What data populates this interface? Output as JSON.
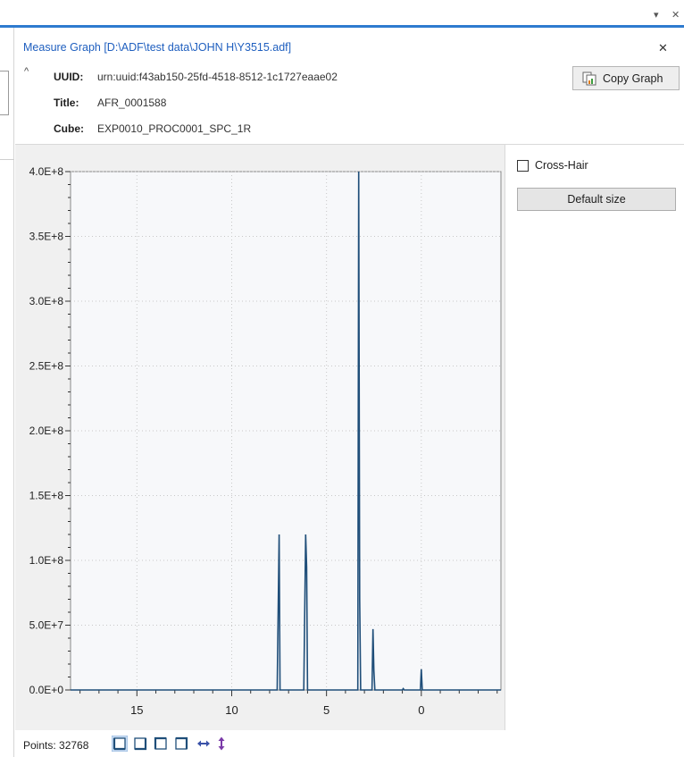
{
  "window": {
    "dropdown_glyph": "▾",
    "close_glyph": "✕"
  },
  "panel": {
    "title": "Measure Graph [D:\\ADF\\test data\\JOHN H\\Y3515.adf]",
    "close_glyph": "✕",
    "collapse_glyph": "^"
  },
  "meta": {
    "uuid_label": "UUID:",
    "uuid_value": "urn:uuid:f43ab150-25fd-4518-8512-1c1727eaae02",
    "title_label": "Title:",
    "title_value": "AFR_0001588",
    "cube_label": "Cube:",
    "cube_value": "EXP0010_PROC0001_SPC_1R"
  },
  "toolbar": {
    "copy_graph_label": "Copy Graph"
  },
  "side": {
    "crosshair_label": "Cross-Hair",
    "crosshair_checked": false,
    "default_size_label": "Default size"
  },
  "status": {
    "points_label": "Points: 32768",
    "icons": [
      "view-bottom-left-icon",
      "view-bottom-right-icon",
      "view-top-left-icon",
      "view-top-right-icon",
      "fit-horizontal-icon",
      "fit-vertical-icon"
    ]
  },
  "colors": {
    "accent": "#2e7bcf",
    "title_blue": "#1f5fbf",
    "trace": "#1f4e79",
    "plot_bg": "#f7f8fa",
    "chart_bg": "#f0f0f0"
  },
  "chart_data": {
    "type": "line",
    "xlabel": "",
    "ylabel": "",
    "xlim": [
      18.5,
      -4.2
    ],
    "ylim": [
      0,
      400000000
    ],
    "x_ticks": [
      15,
      10,
      5,
      0
    ],
    "x_tick_labels": [
      "15",
      "10",
      "5",
      "0"
    ],
    "y_ticks": [
      0,
      50000000,
      100000000,
      150000000,
      200000000,
      250000000,
      300000000,
      350000000,
      400000000
    ],
    "y_tick_labels": [
      "0.0E+0",
      "5.0E+7",
      "1.0E+8",
      "1.5E+8",
      "2.0E+8",
      "2.5E+8",
      "3.0E+8",
      "3.5E+8",
      "4.0E+8"
    ],
    "grid": true,
    "series": [
      {
        "x": [
          18.5,
          7.6,
          7.5,
          7.45,
          7.4,
          6.2,
          6.1,
          6.05,
          6.0,
          3.35,
          3.3,
          3.25,
          3.2,
          2.6,
          2.55,
          2.5,
          2.45,
          1.0,
          0.95,
          0.9,
          0.05,
          0.0,
          -0.05,
          -4.2
        ],
        "y": [
          0,
          0,
          120000000,
          0,
          0,
          0,
          120000000,
          95000000,
          0,
          0,
          400000000,
          70000000,
          0,
          0,
          47000000,
          15000000,
          0,
          0,
          1000000,
          0,
          0,
          16000000,
          0,
          0
        ]
      }
    ]
  }
}
